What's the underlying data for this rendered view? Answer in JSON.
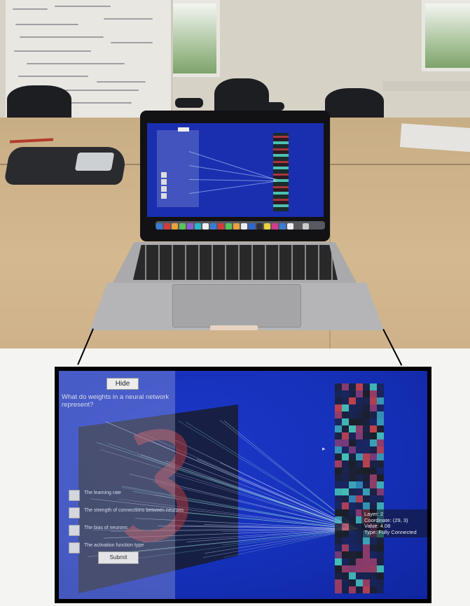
{
  "zoom_screen": {
    "hide_button": "Hide",
    "question": "What do weights in a neural network represent?",
    "options": [
      "The learning rate",
      "The strength of connections between neurons",
      "The bias of neurons",
      "The activation function type"
    ],
    "submit_button": "Submit",
    "tooltip": {
      "layer": "Layer: 2",
      "coordinate": "Coordinate: (29, 3)",
      "value": "Value: 4.08",
      "type": "Type: Fully Connected"
    }
  },
  "colors": {
    "screen_blue": "#1530b8",
    "cell_red": "#c0424a",
    "cell_teal": "#46c2b4",
    "cell_dark": "#1c1f25"
  },
  "icons": {
    "cursor": "mouse-pointer-icon",
    "checkbox": "checkbox-icon"
  }
}
